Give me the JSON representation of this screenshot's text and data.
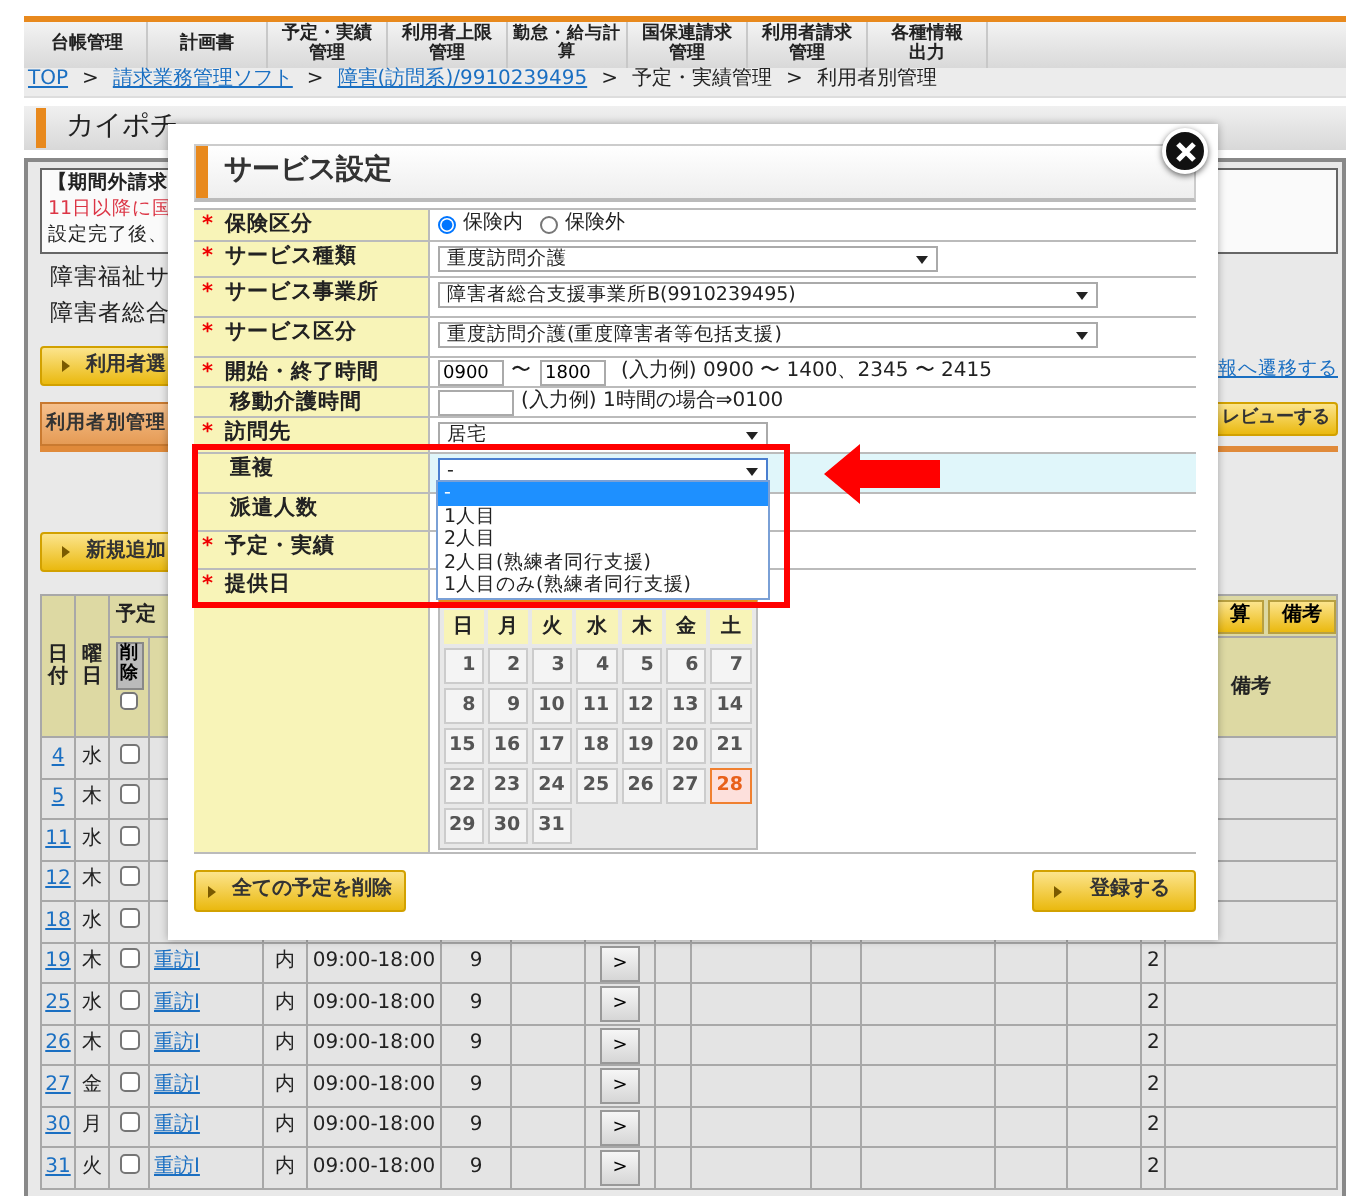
{
  "nav_tabs": [
    {
      "label": "台帳管理"
    },
    {
      "label": "計画書"
    },
    {
      "label": "予定・実績管理"
    },
    {
      "label": "利用者上限管理"
    },
    {
      "label": "勤怠・給与計算"
    },
    {
      "label": "国保連請求管理"
    },
    {
      "label": "利用者請求管理"
    },
    {
      "label": "各種情報出力"
    }
  ],
  "breadcrumb": [
    {
      "text": "TOP",
      "kind": "link"
    },
    {
      "text": ">",
      "kind": "separator"
    },
    {
      "text": "請求業務管理ソフト",
      "kind": "link"
    },
    {
      "text": ">",
      "kind": "separator"
    },
    {
      "text": "障害(訪問系)/9910239495",
      "kind": "link"
    },
    {
      "text": ">",
      "kind": "separator"
    },
    {
      "text": "予定・実績管理",
      "kind": "text"
    },
    {
      "text": ">",
      "kind": "separator"
    },
    {
      "text": "利用者別管理",
      "kind": "text"
    }
  ],
  "page_title": "カイポチ",
  "notice": [
    {
      "text": "【期間外請求",
      "kind": "heading"
    },
    {
      "text": "11日以降に国",
      "kind": "warning"
    },
    {
      "text": "設定完了後、",
      "kind": "normal"
    }
  ],
  "info_lines": [
    "障害福祉サ",
    "障害者総合"
  ],
  "user_select_button": "利用者選",
  "transition_link": "報へ遷移する",
  "manage_tab": "利用者別管理",
  "preview_button": "レビューする",
  "add_button": "新規追加",
  "table": {
    "date_header": "日付",
    "weekday_header": "曜日",
    "plan_header": "予定",
    "delete_button": "削除",
    "header_checked": false,
    "calc_button": "算",
    "note_button": "備考",
    "note_header": "備考",
    "rows": [
      {
        "date": "4",
        "weekday": "水",
        "checked": false
      },
      {
        "date": "5",
        "weekday": "木",
        "checked": false
      },
      {
        "date": "11",
        "weekday": "水",
        "checked": false
      },
      {
        "date": "12",
        "weekday": "木",
        "checked": false
      },
      {
        "date": "18",
        "weekday": "水",
        "checked": false
      },
      {
        "date": "19",
        "weekday": "木",
        "checked": false,
        "service": "重訪Ⅰ",
        "io": "内",
        "time": "09:00-18:00",
        "units": "9",
        "action": ">",
        "count": "2"
      },
      {
        "date": "25",
        "weekday": "水",
        "checked": false,
        "service": "重訪Ⅰ",
        "io": "内",
        "time": "09:00-18:00",
        "units": "9",
        "action": ">",
        "count": "2"
      },
      {
        "date": "26",
        "weekday": "木",
        "checked": false,
        "service": "重訪Ⅰ",
        "io": "内",
        "time": "09:00-18:00",
        "units": "9",
        "action": ">",
        "count": "2"
      },
      {
        "date": "27",
        "weekday": "金",
        "checked": false,
        "service": "重訪Ⅰ",
        "io": "内",
        "time": "09:00-18:00",
        "units": "9",
        "action": ">",
        "count": "2"
      },
      {
        "date": "30",
        "weekday": "月",
        "checked": false,
        "service": "重訪Ⅰ",
        "io": "内",
        "time": "09:00-18:00",
        "units": "9",
        "action": ">",
        "count": "2"
      },
      {
        "date": "31",
        "weekday": "火",
        "checked": false,
        "service": "重訪Ⅰ",
        "io": "内",
        "time": "09:00-18:00",
        "units": "9",
        "action": ">",
        "count": "2"
      }
    ]
  },
  "modal": {
    "title": "サービス設定",
    "required_mark": "*",
    "rows": [
      {
        "label": "保険区分",
        "required": true,
        "highlighted": false,
        "kind": "radio",
        "options": [
          {
            "label": "保険内",
            "selected": true
          },
          {
            "label": "保険外",
            "selected": false
          }
        ]
      },
      {
        "label": "サービス種類",
        "required": true,
        "highlighted": false,
        "kind": "select",
        "value": "重度訪問介護"
      },
      {
        "label": "サービス事業所",
        "required": true,
        "highlighted": false,
        "kind": "select",
        "value": "障害者総合支援事業所B(9910239495)"
      },
      {
        "label": "サービス区分",
        "required": true,
        "highlighted": false,
        "kind": "select",
        "value": "重度訪問介護(重度障害者等包括支援)"
      },
      {
        "label": "開始・終了時間",
        "required": true,
        "highlighted": false,
        "kind": "time_range",
        "start": "0900",
        "separator": "〜",
        "end": "1800",
        "hint": "(入力例) 0900 〜 1400、2345 〜 2415"
      },
      {
        "label": "移動介護時間",
        "required": false,
        "highlighted": false,
        "kind": "time",
        "hint": "(入力例) 1時間の場合⇒0100"
      },
      {
        "label": "訪問先",
        "required": true,
        "highlighted": false,
        "kind": "select",
        "value": "居宅"
      },
      {
        "label": "重複",
        "required": false,
        "highlighted": true,
        "kind": "select_open",
        "value": "-",
        "options": [
          {
            "label": "-",
            "selected": true
          },
          {
            "label": "1人目",
            "selected": false
          },
          {
            "label": "2人目",
            "selected": false
          },
          {
            "label": "2人目(熟練者同行支援)",
            "selected": false
          },
          {
            "label": "1人目のみ(熟練者同行支援)",
            "selected": false
          }
        ]
      },
      {
        "label": "派遣人数",
        "required": false,
        "highlighted": false,
        "kind": "blank"
      },
      {
        "label": "予定・実績",
        "required": true,
        "highlighted": false,
        "kind": "blank"
      },
      {
        "label": "提供日",
        "required": true,
        "highlighted": false,
        "kind": "calendar",
        "weekdays": [
          "日",
          "月",
          "火",
          "水",
          "木",
          "金",
          "土"
        ],
        "days": [
          {
            "day": "1",
            "selected": false
          },
          {
            "day": "2",
            "selected": false
          },
          {
            "day": "3",
            "selected": false
          },
          {
            "day": "4",
            "selected": false
          },
          {
            "day": "5",
            "selected": false
          },
          {
            "day": "6",
            "selected": false
          },
          {
            "day": "7",
            "selected": false
          },
          {
            "day": "8",
            "selected": false
          },
          {
            "day": "9",
            "selected": false
          },
          {
            "day": "10",
            "selected": false
          },
          {
            "day": "11",
            "selected": false
          },
          {
            "day": "12",
            "selected": false
          },
          {
            "day": "13",
            "selected": false
          },
          {
            "day": "14",
            "selected": false
          },
          {
            "day": "15",
            "selected": false
          },
          {
            "day": "16",
            "selected": false
          },
          {
            "day": "17",
            "selected": false
          },
          {
            "day": "18",
            "selected": false
          },
          {
            "day": "19",
            "selected": false
          },
          {
            "day": "20",
            "selected": false
          },
          {
            "day": "21",
            "selected": false
          },
          {
            "day": "22",
            "selected": false
          },
          {
            "day": "23",
            "selected": false
          },
          {
            "day": "24",
            "selected": false
          },
          {
            "day": "25",
            "selected": false
          },
          {
            "day": "26",
            "selected": false
          },
          {
            "day": "27",
            "selected": false
          },
          {
            "day": "28",
            "selected": true
          },
          {
            "day": "29",
            "selected": false
          },
          {
            "day": "30",
            "selected": false
          },
          {
            "day": "31",
            "selected": false
          }
        ]
      }
    ],
    "delete_all_button": "全ての予定を削除",
    "register_button": "登録する"
  }
}
